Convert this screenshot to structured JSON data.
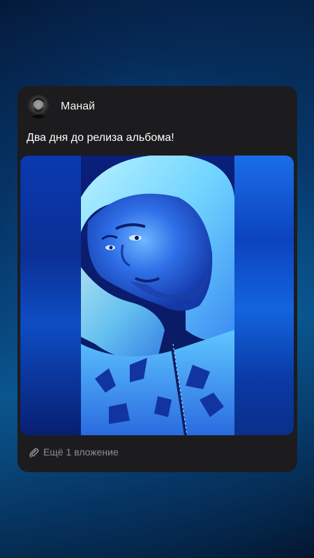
{
  "post": {
    "author": "Манай",
    "text": "Два дня до релиза альбома!",
    "attachments_label": "Ещё 1 вложение"
  },
  "icons": {
    "avatar": "avatar",
    "attachment": "paperclip-icon"
  },
  "colors": {
    "card_background": "#1c1c1e",
    "muted_text": "#8e8e93",
    "media_tint": "#1e5bff"
  }
}
